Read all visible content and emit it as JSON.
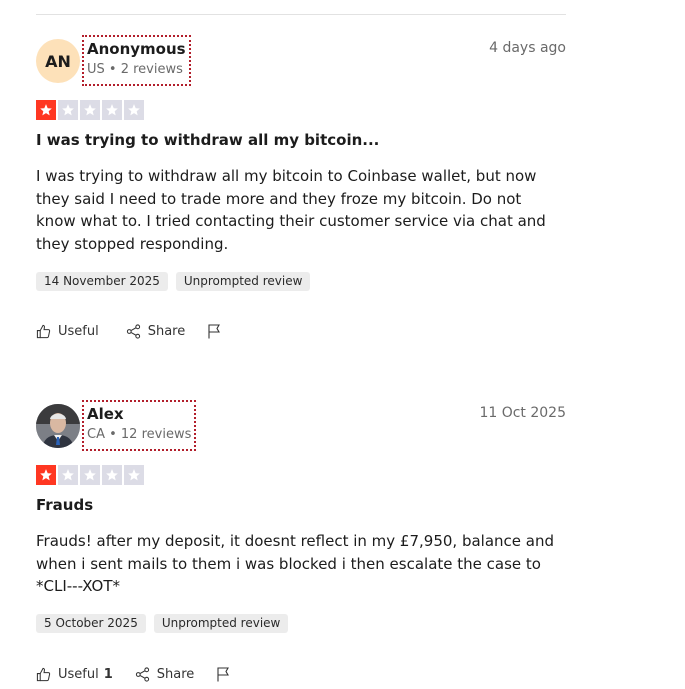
{
  "reviews": [
    {
      "avatar_initials": "AN",
      "avatar_type": "initials",
      "user_name": "Anonymous",
      "user_meta": "US • 2 reviews",
      "date_label": "4 days ago",
      "rating": 1,
      "title": "I was trying to withdraw all my bitcoin...",
      "body": "I was trying to withdraw all my bitcoin to Coinbase wallet, but now they said I need to trade more and they froze my bitcoin. Do not know what to. I tried contacting their customer service via chat and they stopped responding.",
      "experience_date": "14 November 2025",
      "review_type": "Unprompted review",
      "useful_label": "Useful",
      "useful_count": "",
      "share_label": "Share"
    },
    {
      "avatar_type": "photo",
      "user_name": "Alex",
      "user_meta": "CA • 12 reviews",
      "date_label": "11 Oct 2025",
      "rating": 1,
      "title": "Frauds",
      "body": "Frauds! after my deposit, it doesnt reflect in my £7,950, balance and when i sent mails to them i was blocked i then escalate the case to *CLI---XOT*",
      "experience_date": "5 October 2025",
      "review_type": "Unprompted review",
      "useful_label": "Useful",
      "useful_count": "1",
      "share_label": "Share"
    }
  ],
  "colors": {
    "star_filled": "#ff3722",
    "star_empty": "#dcdce6",
    "avatar_bg": "#fde1b9",
    "tag_bg": "#ececec"
  },
  "icons": {
    "useful": "thumbs-up-icon",
    "share": "share-icon",
    "report": "flag-icon"
  }
}
